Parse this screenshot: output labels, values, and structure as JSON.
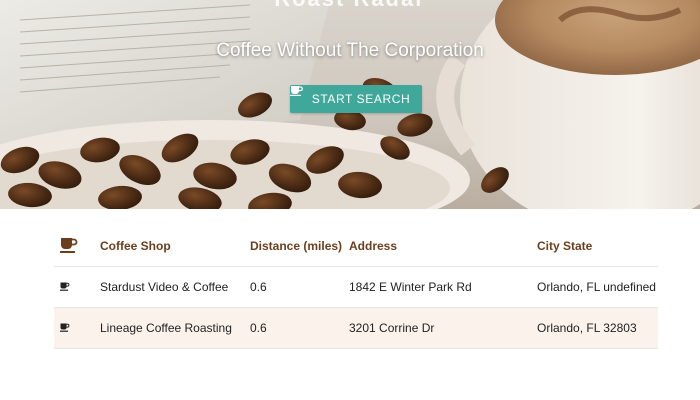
{
  "hero": {
    "cut_title": "Roast Radar",
    "subtitle": "Coffee Without The Corporation",
    "search_button_label": "START SEARCH",
    "accent_color": "#3fa89a",
    "icon": "coffee-cup-icon"
  },
  "table": {
    "header_icon": "coffee-cup-icon",
    "columns": [
      "Coffee Shop",
      "Distance (miles)",
      "Address",
      "City State"
    ],
    "rows": [
      {
        "icon": "coffee-cup-icon",
        "shop": "Stardust Video & Coffee",
        "distance": "0.6",
        "address": "1842 E Winter Park Rd",
        "city_state": "Orlando, FL undefined"
      },
      {
        "icon": "coffee-cup-icon",
        "shop": "Lineage Coffee Roasting",
        "distance": "0.6",
        "address": "3201 Corrine Dr",
        "city_state": "Orlando, FL 32803"
      }
    ],
    "header_color": "#6b3f1d",
    "alt_row_color": "#fbf2ec"
  }
}
